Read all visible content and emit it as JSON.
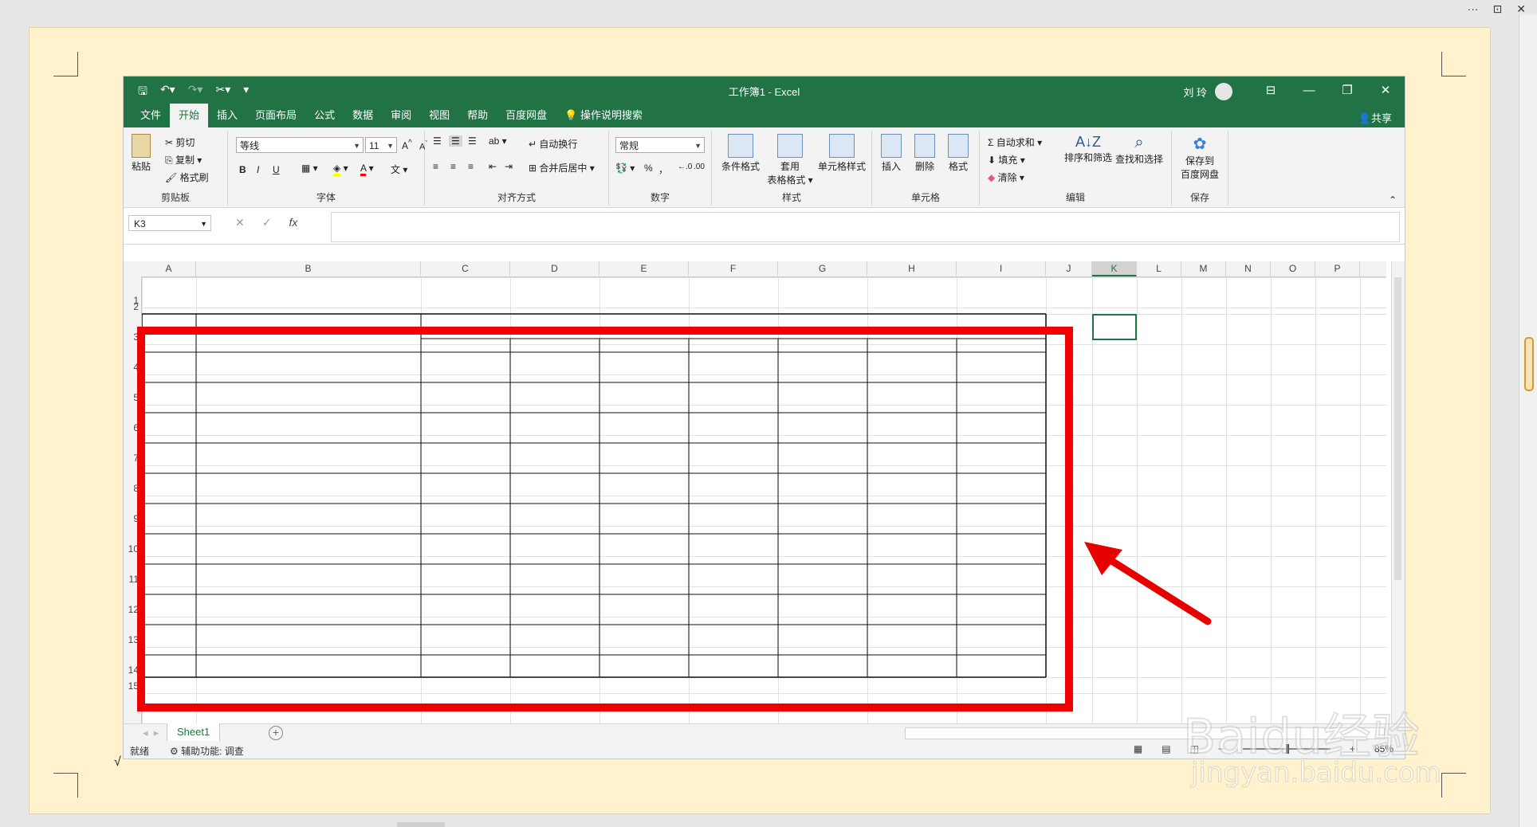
{
  "excel": {
    "title": "工作簿1  -  Excel",
    "user_name": "刘 玲",
    "qat_icons": [
      "save-icon",
      "undo-icon",
      "redo-icon",
      "cut-icon",
      "customize-icon"
    ],
    "tabs": [
      "文件",
      "开始",
      "插入",
      "页面布局",
      "公式",
      "数据",
      "审阅",
      "视图",
      "帮助",
      "百度网盘",
      "操作说明搜索"
    ],
    "active_tab": "开始",
    "share_label": "共享"
  },
  "ribbon": {
    "clipboard": {
      "paste": "粘贴",
      "cut": "剪切",
      "copy": "复制",
      "format_painter": "格式刷",
      "label": "剪贴板"
    },
    "font": {
      "name": "等线",
      "size": "11",
      "bold": "B",
      "italic": "I",
      "underline": "U",
      "label": "字体"
    },
    "alignment": {
      "wrap": "自动换行",
      "merge": "合并后居中",
      "label": "对齐方式"
    },
    "number": {
      "format": "常规",
      "percent": "%",
      "comma": "，",
      "label": "数字"
    },
    "styles": {
      "conditional": "条件格式",
      "table_line1": "套用",
      "table_line2": "表格格式",
      "cell_styles": "单元格样式",
      "label": "样式"
    },
    "cells": {
      "insert": "插入",
      "delete": "删除",
      "format": "格式",
      "label": "单元格"
    },
    "editing": {
      "autosum": "自动求和",
      "fill": "填充",
      "clear": "清除",
      "sort": "排序和筛选",
      "find": "查找和选择",
      "label": "编辑"
    },
    "save": {
      "line1": "保存到",
      "line2": "百度网盘",
      "label": "保存"
    }
  },
  "formula_bar": {
    "name_box": "K3",
    "fx": "fx",
    "value": ""
  },
  "columns": [
    "A",
    "B",
    "C",
    "D",
    "E",
    "F",
    "G",
    "H",
    "I",
    "J",
    "K",
    "L",
    "M",
    "N",
    "O",
    "P"
  ],
  "selected_column": "K",
  "rows": [
    "1",
    "2",
    "3",
    "4",
    "5",
    "6",
    "7",
    "8",
    "9",
    "10",
    "11",
    "12",
    "13",
    "14",
    "15"
  ],
  "sheet": {
    "tab_name": "Sheet1"
  },
  "status": {
    "ready": "就绪",
    "accessibility": "辅助功能: 调查",
    "zoom": "85%"
  },
  "page_mark": "√",
  "watermark": {
    "line1": "Baidu经验",
    "line2": "jingyan.baidu.com"
  },
  "annotation": {
    "box_color": "#f00000",
    "arrow_color": "#e60000"
  },
  "colors": {
    "excel_green": "#217346",
    "page_bg": "#fff2cc"
  }
}
